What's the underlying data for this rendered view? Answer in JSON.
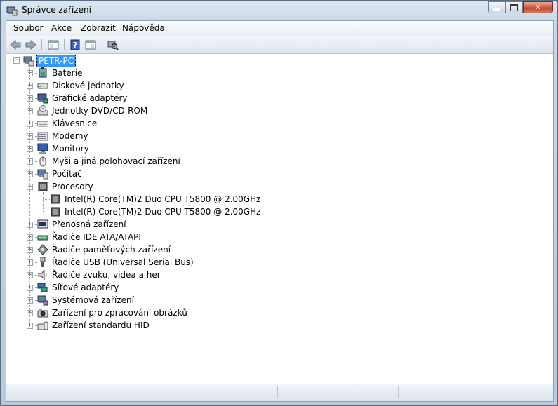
{
  "window": {
    "title": "Správce zařízení"
  },
  "menu": [
    {
      "label": "Soubor",
      "key": "S",
      "rest": "oubor"
    },
    {
      "label": "Akce",
      "key": "A",
      "rest": "kce"
    },
    {
      "label": "Zobrazit",
      "key": "Z",
      "rest": "obrazit"
    },
    {
      "label": "Nápověda",
      "key": "N",
      "rest": "ápověda"
    }
  ],
  "toolbar": {
    "buttons": [
      "back-icon",
      "forward-icon",
      "show-hide-console-tree-icon",
      "help-icon",
      "properties-icon",
      "scan-hardware-icon"
    ]
  },
  "tree": {
    "root": "PETR-PC",
    "categories": [
      {
        "label": "Baterie",
        "icon": "battery-icon",
        "expanded": false
      },
      {
        "label": "Diskové jednotky",
        "icon": "disk-drive-icon",
        "expanded": false
      },
      {
        "label": "Grafické adaptéry",
        "icon": "display-adapter-icon",
        "expanded": false
      },
      {
        "label": "Jednotky DVD/CD-ROM",
        "icon": "dvd-drive-icon",
        "expanded": false
      },
      {
        "label": "Klávesnice",
        "icon": "keyboard-icon",
        "expanded": false
      },
      {
        "label": "Modemy",
        "icon": "modem-icon",
        "expanded": false
      },
      {
        "label": "Monitory",
        "icon": "monitor-icon",
        "expanded": false
      },
      {
        "label": "Myši a jiná polohovací zařízení",
        "icon": "mouse-icon",
        "expanded": false
      },
      {
        "label": "Počítač",
        "icon": "computer-icon",
        "expanded": false
      },
      {
        "label": "Procesory",
        "icon": "processor-icon",
        "expanded": true,
        "children": [
          "Intel(R) Core(TM)2 Duo CPU     T5800  @ 2.00GHz",
          "Intel(R) Core(TM)2 Duo CPU     T5800  @ 2.00GHz"
        ]
      },
      {
        "label": "Přenosná zařízení",
        "icon": "portable-device-icon",
        "expanded": false
      },
      {
        "label": "Řadiče IDE ATA/ATAPI",
        "icon": "ide-controller-icon",
        "expanded": false
      },
      {
        "label": "Řadiče paměťových zařízení",
        "icon": "storage-controller-icon",
        "expanded": false
      },
      {
        "label": "Řadiče USB (Universal Serial Bus)",
        "icon": "usb-icon",
        "expanded": false
      },
      {
        "label": "Řadiče zvuku, videa a her",
        "icon": "sound-icon",
        "expanded": false
      },
      {
        "label": "Síťové adaptéry",
        "icon": "network-adapter-icon",
        "expanded": false
      },
      {
        "label": "Systémová zařízení",
        "icon": "system-device-icon",
        "expanded": false
      },
      {
        "label": "Zařízení pro zpracování obrázků",
        "icon": "imaging-device-icon",
        "expanded": false
      },
      {
        "label": "Zařízení standardu HID",
        "icon": "hid-icon",
        "expanded": false
      }
    ]
  },
  "colors": {
    "selection": "#3399ff",
    "window_frame": "#c9d7e6"
  }
}
